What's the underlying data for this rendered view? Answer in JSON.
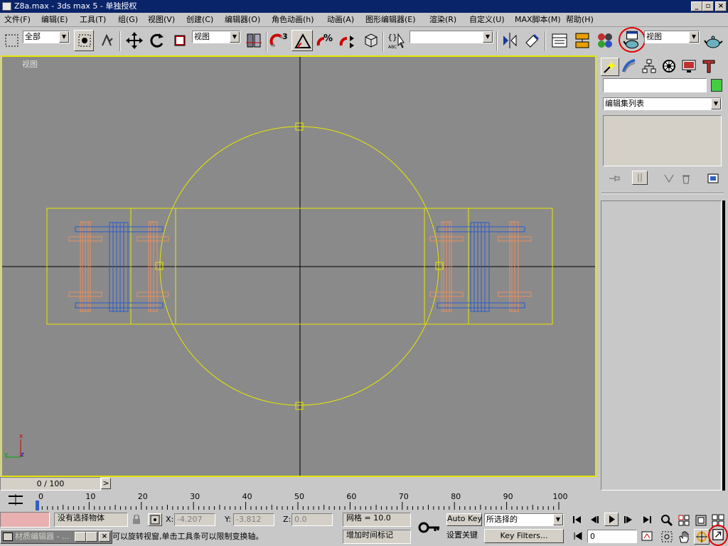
{
  "window": {
    "title": "Z8a.max - 3ds max 5 - 单独授权",
    "minimize_label": "_",
    "maximize_label": "▫",
    "close_label": "×"
  },
  "menu": [
    "文件(F)",
    "编辑(E)",
    "工具(T)",
    "组(G)",
    "视图(V)",
    "创建(C)",
    "编辑器(O)",
    "角色动画(h)",
    "动画(A)",
    "图形编辑器(E)",
    "渲染(R)",
    "自定义(U)",
    "MAX脚本(M)",
    "帮助(H)"
  ],
  "toolbar": {
    "selection_filter": "全部",
    "ref_coord": "视图",
    "snap_angle_label": "3",
    "named_selection": "",
    "render_type": "视图",
    "abc_label": "ABC"
  },
  "viewport": {
    "label": "视图",
    "axis_x": "x",
    "axis_y": "y",
    "axis_z": "z",
    "background": "#8a8a8a",
    "border_color": "#e6e600"
  },
  "command_panel": {
    "name_field": "",
    "color_swatch": "#44cc44",
    "modifier_list": "编辑集列表"
  },
  "time": {
    "slider_text": "0 / 100",
    "prev_label": "<",
    "next_label": ">",
    "ruler_ticks": [
      "0",
      "10",
      "20",
      "30",
      "40",
      "50",
      "60",
      "70",
      "80",
      "90",
      "100"
    ]
  },
  "status": {
    "selection_status": "没有选择物体",
    "x_label": "X:",
    "x_value": "-4.207",
    "y_label": "Y:",
    "y_value": "-3.812",
    "z_label": "Z:",
    "z_value": "0.0",
    "grid": "网格 = 10.0",
    "auto_key": "Auto Key",
    "selected_set": "所选择的",
    "set_key_partial": "设置关键",
    "key_filters": "Key Filters...",
    "add_time_tag": "增加时间标记",
    "prompt": "可以旋转视窗,单击工具条可以限制变换轴。",
    "current_frame": "0"
  },
  "taskbar_window": {
    "title": "材质编辑器 - ...",
    "close_label": "×"
  }
}
